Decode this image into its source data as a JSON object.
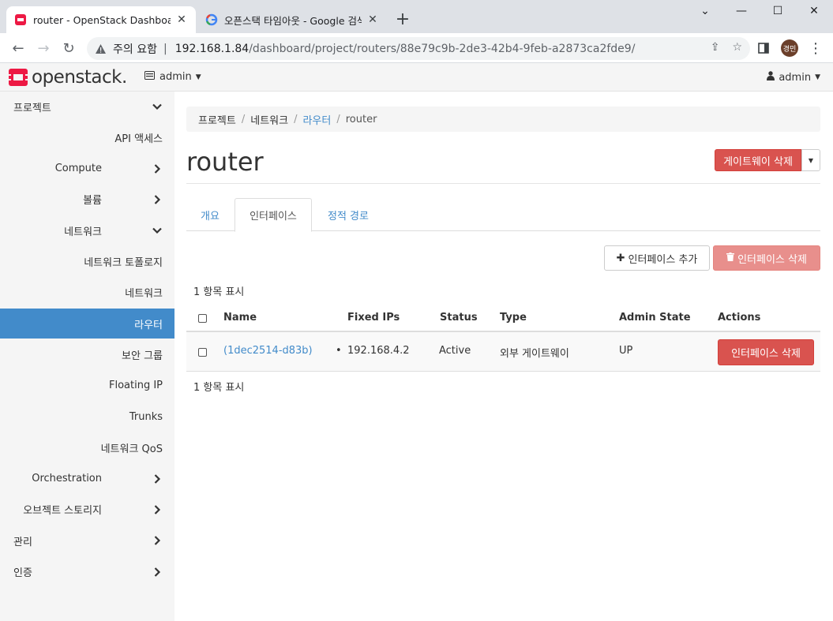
{
  "browser": {
    "tabs": [
      {
        "title": "router - OpenStack Dashboard",
        "active": true
      },
      {
        "title": "오픈스택 타임아웃 - Google 검색",
        "active": false
      }
    ],
    "address": {
      "security_label": "주의 요함",
      "host": "192.168.1.84",
      "path": "/dashboard/project/routers/88e79c9b-2de3-42b4-9feb-a2873ca2fde9/"
    },
    "profile_label": "경민"
  },
  "header": {
    "logo_text": "openstack.",
    "project": "admin",
    "user": "admin"
  },
  "sidebar": {
    "items": [
      {
        "label": "프로젝트",
        "level": 0,
        "chevron": "down"
      },
      {
        "label": "API 액세스",
        "level": 2
      },
      {
        "label": "Compute",
        "level": 1,
        "chevron": "right"
      },
      {
        "label": "볼륨",
        "level": 1,
        "chevron": "right"
      },
      {
        "label": "네트워크",
        "level": 1,
        "chevron": "down"
      },
      {
        "label": "네트워크 토폴로지",
        "level": 2
      },
      {
        "label": "네트워크",
        "level": 2
      },
      {
        "label": "라우터",
        "level": 2,
        "active": true
      },
      {
        "label": "보안 그룹",
        "level": 2
      },
      {
        "label": "Floating IP",
        "level": 2
      },
      {
        "label": "Trunks",
        "level": 2
      },
      {
        "label": "네트워크 QoS",
        "level": 2
      },
      {
        "label": "Orchestration",
        "level": 1,
        "chevron": "right"
      },
      {
        "label": "오브젝트 스토리지",
        "level": 1,
        "chevron": "right"
      },
      {
        "label": "관리",
        "level": 0,
        "chevron": "right"
      },
      {
        "label": "인증",
        "level": 0,
        "chevron": "right"
      }
    ]
  },
  "main": {
    "breadcrumb": [
      "프로젝트",
      "네트워크",
      "라우터",
      "router"
    ],
    "title": "router",
    "delete_gateway_label": "게이트웨이 삭제",
    "tabs": [
      "개요",
      "인터페이스",
      "정적 경로"
    ],
    "add_interface_label": "인터페이스 추가",
    "delete_interfaces_label": "인터페이스 삭제",
    "count_text": "1 항목 표시",
    "table": {
      "headers": [
        "Name",
        "Fixed IPs",
        "Status",
        "Type",
        "Admin State",
        "Actions"
      ],
      "rows": [
        {
          "name": "(1dec2514-d83b)",
          "fixed_ip": "192.168.4.2",
          "status": "Active",
          "type": "외부 게이트웨이",
          "admin_state": "UP",
          "action": "인터페이스 삭제"
        }
      ]
    }
  }
}
